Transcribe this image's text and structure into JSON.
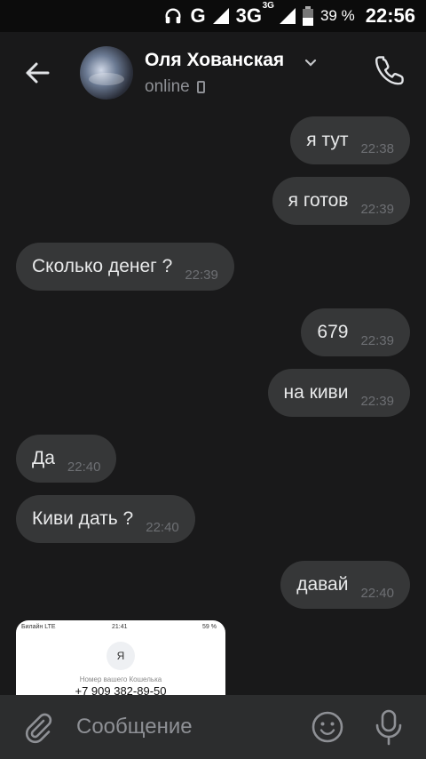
{
  "status_bar": {
    "network": "G",
    "network2": "3G",
    "network2_sup": "3G",
    "battery": "39 %",
    "time": "22:56"
  },
  "header": {
    "name": "Оля Хованская",
    "status": "online"
  },
  "messages": [
    {
      "direction": "out",
      "text": "я тут",
      "time": "22:38"
    },
    {
      "direction": "out",
      "text": "я готов",
      "time": "22:39"
    },
    {
      "direction": "in",
      "text": "Сколько денег ?",
      "time": "22:39"
    },
    {
      "direction": "out",
      "text": "679",
      "time": "22:39"
    },
    {
      "direction": "out",
      "text": "на киви",
      "time": "22:39"
    },
    {
      "direction": "in",
      "text": "Да",
      "time": "22:40"
    },
    {
      "direction": "in",
      "text": "Киви дать ?",
      "time": "22:40"
    },
    {
      "direction": "out",
      "text": "давай",
      "time": "22:40"
    }
  ],
  "attachment": {
    "carrier": "Билайн LTE",
    "time": "21:41",
    "battery": "59 %",
    "avatar_letter": "Я",
    "label": "Номер вашего Кошелька",
    "number": "+7 909 382-89-50"
  },
  "composer": {
    "placeholder": "Сообщение"
  },
  "colors": {
    "background": "#19191a",
    "bubble": "#363738",
    "composer": "#2c2d2e"
  }
}
